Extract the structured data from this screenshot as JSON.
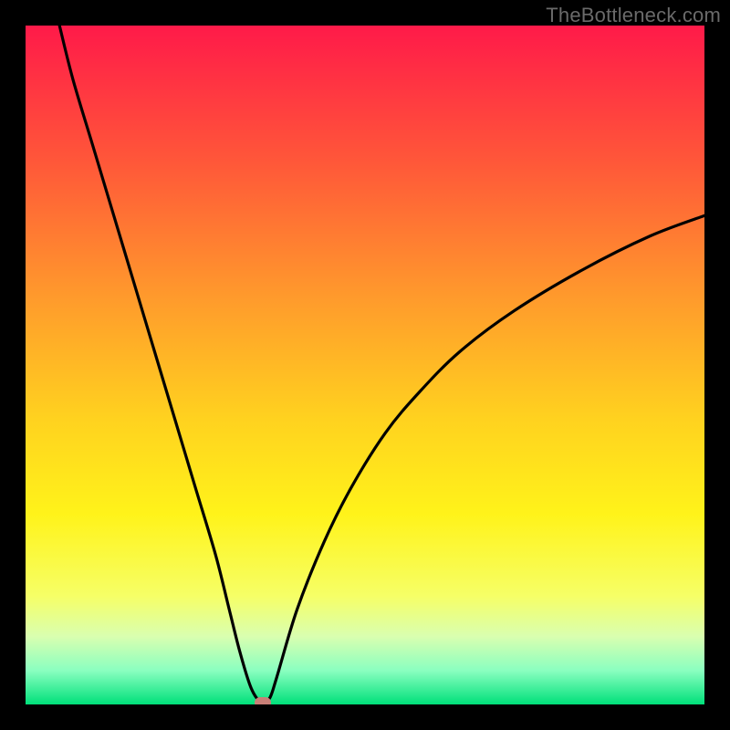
{
  "watermark": "TheBottleneck.com",
  "chart_data": {
    "type": "line",
    "title": "",
    "xlabel": "",
    "ylabel": "",
    "xlim": [
      0,
      100
    ],
    "ylim": [
      0,
      100
    ],
    "grid": false,
    "legend": false,
    "gradient_stops": [
      {
        "offset": 0.0,
        "color": "#ff1a49"
      },
      {
        "offset": 0.2,
        "color": "#ff5739"
      },
      {
        "offset": 0.4,
        "color": "#ff9a2c"
      },
      {
        "offset": 0.58,
        "color": "#ffd21f"
      },
      {
        "offset": 0.72,
        "color": "#fff31a"
      },
      {
        "offset": 0.84,
        "color": "#f6ff66"
      },
      {
        "offset": 0.9,
        "color": "#d9ffb0"
      },
      {
        "offset": 0.95,
        "color": "#8affc0"
      },
      {
        "offset": 1.0,
        "color": "#00e07a"
      }
    ],
    "series": [
      {
        "name": "bottleneck-curve",
        "x": [
          5,
          7,
          10,
          13,
          16,
          19,
          22,
          25,
          28,
          30,
          31.5,
          33,
          34,
          35,
          36,
          37,
          40,
          44,
          48,
          53,
          58,
          64,
          72,
          82,
          92,
          100
        ],
        "y": [
          100,
          92,
          82,
          72,
          62,
          52,
          42,
          32,
          22,
          14,
          8,
          3,
          1,
          0.3,
          1,
          4,
          14,
          24,
          32,
          40,
          46,
          52,
          58,
          64,
          69,
          72
        ]
      }
    ],
    "marker": {
      "x": 35,
      "y": 0.3,
      "color": "#c97f77"
    },
    "annotations": []
  }
}
